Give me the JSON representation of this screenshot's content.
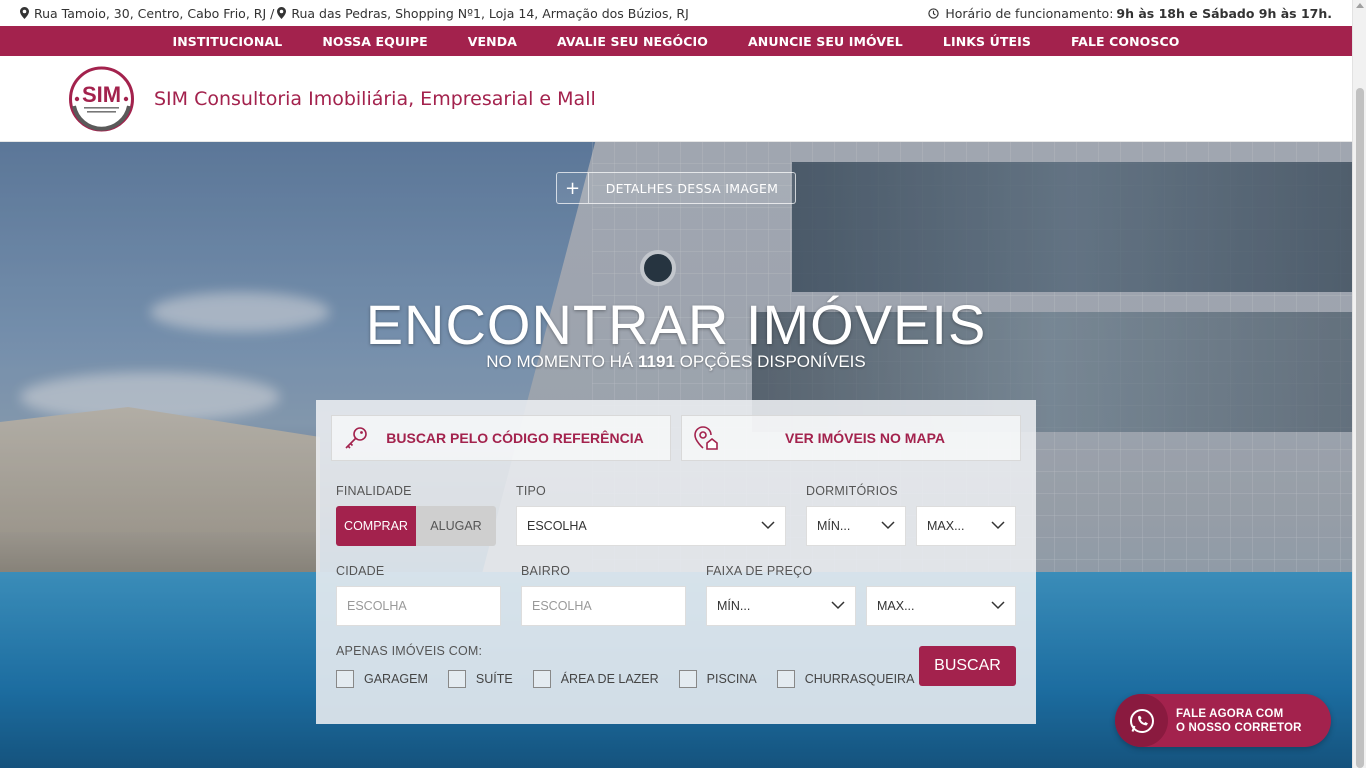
{
  "topbar": {
    "address_1": "Rua Tamoio, 30, Centro, Cabo Frio, RJ /",
    "address_2": "Rua das Pedras, Shopping Nº1, Loja 14, Armação dos Búzios, RJ",
    "hours_label": "Horário de funcionamento:",
    "hours_value": "9h às 18h e Sábado 9h às 17h."
  },
  "nav": {
    "items": [
      {
        "label": "INSTITUCIONAL"
      },
      {
        "label": "NOSSA EQUIPE"
      },
      {
        "label": "VENDA"
      },
      {
        "label": "AVALIE SEU NEGÓCIO"
      },
      {
        "label": "ANUNCIE SEU IMÓVEL"
      },
      {
        "label": "LINKS ÚTEIS"
      },
      {
        "label": "FALE CONOSCO"
      }
    ]
  },
  "header": {
    "logo_text": "SIM",
    "logo_subtext": "CONSULTORIA IMOBILIÁRIA EMPRESARIAL E MALL",
    "brand": "SIM Consultoria Imobiliária, Empresarial e Mall"
  },
  "hero": {
    "details_label": "DETALHES DESSA IMAGEM",
    "title": "ENCONTRAR IMÓVEIS",
    "subtitle_prefix": "NO MOMENTO HÁ",
    "count": "1191",
    "subtitle_suffix": "OPÇÕES DISPONÍVEIS"
  },
  "search": {
    "ref_label": "BUSCAR PELO CÓDIGO REFERÊNCIA",
    "map_label": "VER IMÓVEIS NO MAPA",
    "finalidade_label": "FINALIDADE",
    "finalidade_options": {
      "comprar": "COMPRAR",
      "alugar": "ALUGAR"
    },
    "tipo_label": "TIPO",
    "tipo_value": "ESCOLHA",
    "dormitorios_label": "DORMITÓRIOS",
    "dorm_min": "MÍN...",
    "dorm_max": "MAX...",
    "cidade_label": "CIDADE",
    "cidade_placeholder": "ESCOLHA",
    "bairro_label": "BAIRRO",
    "bairro_placeholder": "ESCOLHA",
    "preco_label": "FAIXA DE PREÇO",
    "preco_min": "MÍN...",
    "preco_max": "MAX...",
    "apenas_label": "APENAS IMÓVEIS COM:",
    "checkboxes": [
      {
        "label": "GARAGEM"
      },
      {
        "label": "SUÍTE"
      },
      {
        "label": "ÁREA DE LAZER"
      },
      {
        "label": "PISCINA"
      },
      {
        "label": "CHURRASQUEIRA"
      }
    ],
    "buscar_label": "BUSCAR"
  },
  "whatsapp": {
    "line1": "FALE AGORA COM",
    "line2": "O NOSSO CORRETOR"
  },
  "colors": {
    "brand": "#a3224d",
    "whatsapp_dark": "#8a1a3f"
  }
}
